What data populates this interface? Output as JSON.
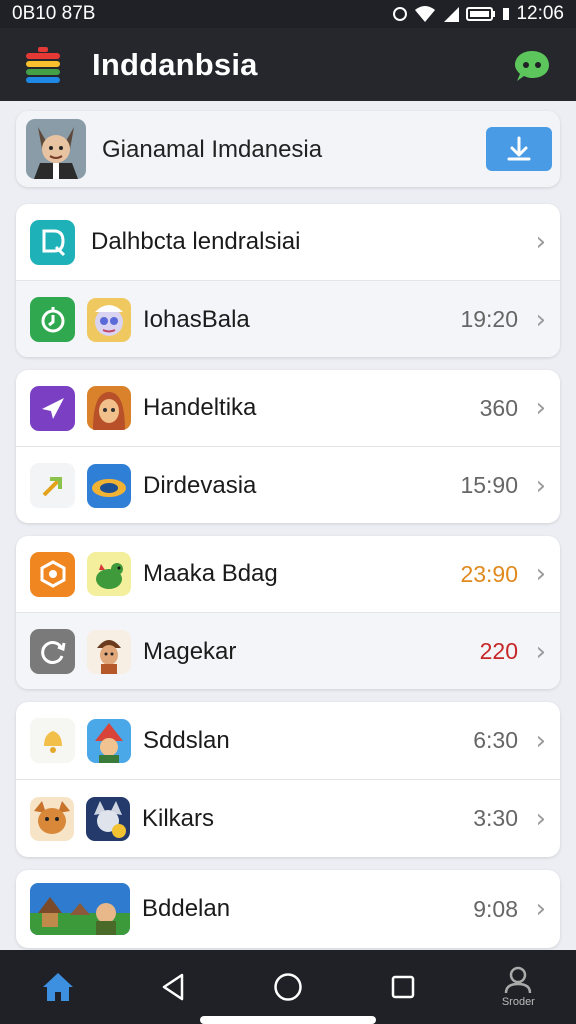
{
  "status": {
    "left": "0B10 87B",
    "time": "12:06"
  },
  "app": {
    "title": "Inddanbsia"
  },
  "banner": {
    "label": "Gianamal Imdanesia"
  },
  "card1": {
    "rows": [
      {
        "label": "Dalhbcta lendralsiai",
        "value": ""
      },
      {
        "label": "IohasBala",
        "value": "19:20"
      }
    ]
  },
  "card2": {
    "rows": [
      {
        "label": "Handeltika",
        "value": "360"
      },
      {
        "label": "Dirdevasia",
        "value": "15:90"
      }
    ]
  },
  "card3": {
    "rows": [
      {
        "label": "Maaka Bdag",
        "value": "23:90",
        "value_color": "#e08a1e"
      },
      {
        "label": "Magekar",
        "value": "220",
        "value_color": "#c62828"
      }
    ]
  },
  "card4": {
    "rows": [
      {
        "label": "Sddslan",
        "value": "6:30"
      },
      {
        "label": "Kilkars",
        "value": "3:30"
      }
    ]
  },
  "card5": {
    "rows": [
      {
        "label": "Bddelan",
        "value": "9:08"
      }
    ]
  },
  "nav": {
    "profile_label": "Sroder"
  },
  "colors": {
    "accent_blue": "#3d8fe0",
    "download_blue": "#4a9be6",
    "chat_green": "#5cc65c"
  }
}
